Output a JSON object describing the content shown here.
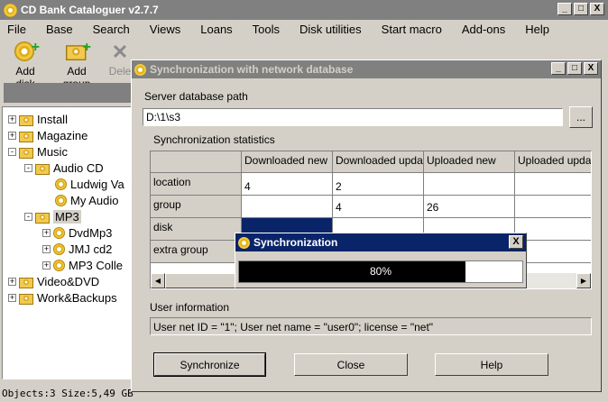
{
  "app": {
    "title": "CD Bank Cataloguer v2.7.7",
    "window_controls": [
      "_",
      "□",
      "X"
    ]
  },
  "menu": [
    "File",
    "Base",
    "Search",
    "Views",
    "Loans",
    "Tools",
    "Disk utilities",
    "Start macro",
    "Add-ons",
    "Help"
  ],
  "toolbar": {
    "add_disk": "Add disk",
    "add_group": "Add group",
    "delete": "Dele"
  },
  "tree": [
    {
      "label": "Install",
      "level": 0,
      "expander": "+",
      "icon": "folder-disk-icon"
    },
    {
      "label": "Magazine",
      "level": 0,
      "expander": "+",
      "icon": "folder-disk-icon"
    },
    {
      "label": "Music",
      "level": 0,
      "expander": "-",
      "icon": "folder-disk-icon"
    },
    {
      "label": "Audio CD",
      "level": 1,
      "expander": "-",
      "icon": "folder-disk-icon"
    },
    {
      "label": "Ludwig Va",
      "level": 2,
      "expander": "",
      "icon": "cd-icon"
    },
    {
      "label": "My Audio",
      "level": 2,
      "expander": "",
      "icon": "cd-icon"
    },
    {
      "label": "MP3",
      "level": 1,
      "expander": "-",
      "icon": "folder-disk-icon",
      "selected": true
    },
    {
      "label": "DvdMp3",
      "level": 2,
      "expander": "+",
      "icon": "cd-icon"
    },
    {
      "label": "JMJ cd2",
      "level": 2,
      "expander": "+",
      "icon": "cd-icon"
    },
    {
      "label": "MP3 Colle",
      "level": 2,
      "expander": "+",
      "icon": "cd-icon"
    },
    {
      "label": "Video&DVD",
      "level": 0,
      "expander": "+",
      "icon": "folder-disk-icon"
    },
    {
      "label": "Work&Backups",
      "level": 0,
      "expander": "+",
      "icon": "folder-disk-icon"
    }
  ],
  "status": "Objects:3 Size:5,49 GB",
  "dialog": {
    "title": "Synchronization with network database",
    "server_path_label": "Server database path",
    "server_path_value": "D:\\1\\s3",
    "browse_label": "...",
    "stats_label": "Synchronization statistics",
    "columns": [
      "",
      "Downloaded new",
      "Downloaded updated",
      "Uploaded new",
      "Uploaded updated"
    ],
    "rows": [
      {
        "name": "location",
        "values": [
          "4",
          "2",
          "",
          ""
        ]
      },
      {
        "name": "group",
        "values": [
          "",
          "4",
          "26",
          ""
        ]
      },
      {
        "name": "disk",
        "values": [
          "",
          "",
          "",
          ""
        ]
      },
      {
        "name": "extra group",
        "values": [
          "",
          "",
          "",
          ""
        ]
      }
    ],
    "user_info_label": "User information",
    "user_info_value": "User net ID = \"1\"; User net name = \"user0\"; license = \"net\"",
    "buttons": {
      "synchronize": "Synchronize",
      "close": "Close",
      "help": "Help"
    }
  },
  "sync_popup": {
    "title": "Synchronization",
    "progress": 80,
    "progress_text": "80%",
    "close": "X"
  }
}
